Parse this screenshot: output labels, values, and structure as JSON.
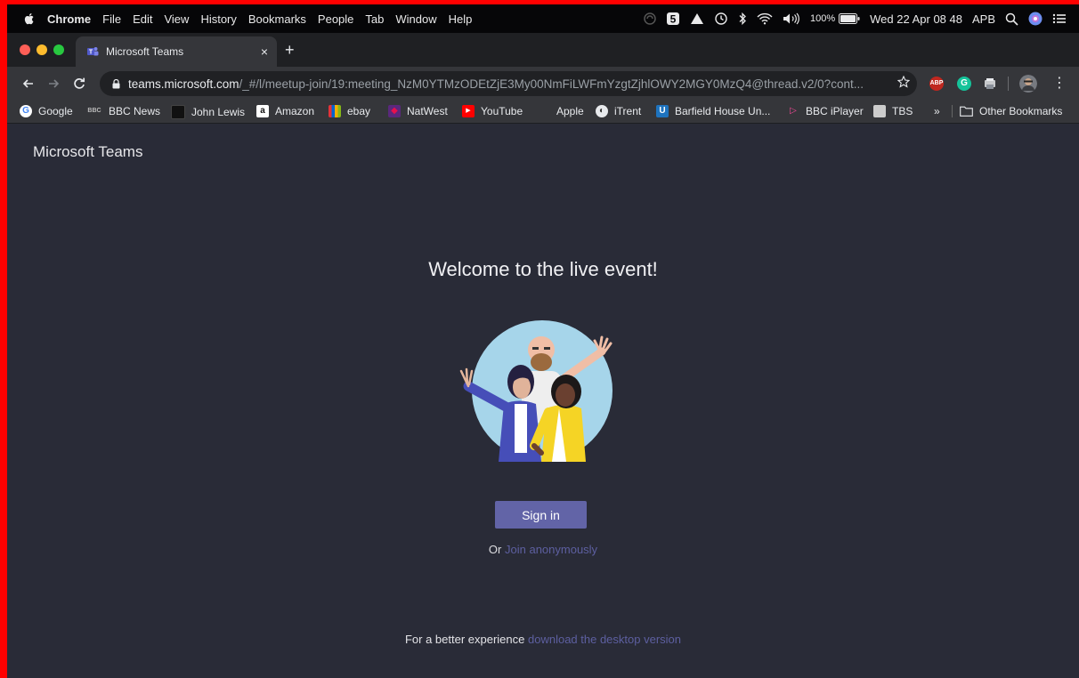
{
  "menubar": {
    "app": "Chrome",
    "items": [
      "File",
      "Edit",
      "View",
      "History",
      "Bookmarks",
      "People",
      "Tab",
      "Window",
      "Help"
    ],
    "battery": "100%",
    "datetime": "Wed 22 Apr  08 48",
    "user": "APB"
  },
  "tab": {
    "title": "Microsoft Teams",
    "close": "×",
    "new_tab": "+"
  },
  "toolbar": {
    "url_host": "teams.microsoft.com",
    "url_rest": "/_#/l/meetup-join/19:meeting_NzM0YTMzODEtZjE3My00NmFiLWFmYzgtZjhlOWY2MGY0MzQ4@thread.v2/0?cont..."
  },
  "bookmarks": {
    "items": [
      {
        "label": "Google",
        "icon": "google-icon"
      },
      {
        "label": "BBC News",
        "icon": "bbc-icon"
      },
      {
        "label": "John Lewis",
        "icon": "john-lewis-icon"
      },
      {
        "label": "Amazon",
        "icon": "amazon-icon"
      },
      {
        "label": "ebay",
        "icon": "ebay-icon"
      },
      {
        "label": "NatWest",
        "icon": "natwest-icon"
      },
      {
        "label": "YouTube",
        "icon": "youtube-icon"
      },
      {
        "label": "Apple",
        "icon": "apple-icon"
      },
      {
        "label": "iTrent",
        "icon": "itrent-icon"
      },
      {
        "label": "Barfield House Un...",
        "icon": "barfield-icon"
      },
      {
        "label": "BBC iPlayer",
        "icon": "iplayer-icon"
      },
      {
        "label": "TBS",
        "icon": "tbs-icon"
      }
    ],
    "overflow": "»",
    "other": "Other Bookmarks"
  },
  "page": {
    "brand": "Microsoft Teams",
    "welcome": "Welcome to the live event!",
    "signin": "Sign in",
    "or_prefix": "Or",
    "join_anon": "Join anonymously",
    "better_prefix": "For a better experience",
    "download_link": "download the desktop version"
  },
  "colors": {
    "background": "#292b37",
    "accent": "#6264a7",
    "link": "#5d5fa0"
  }
}
